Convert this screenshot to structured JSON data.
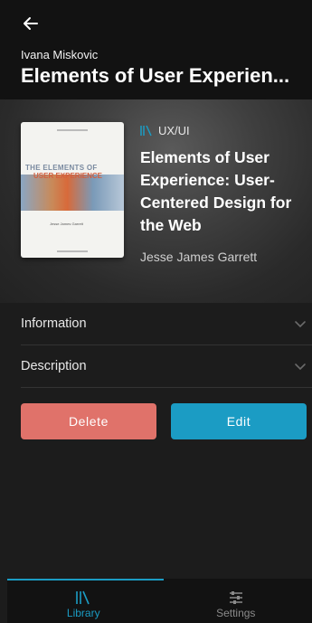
{
  "header": {
    "subtitle": "Ivana Miskovic",
    "title": "Elements of User Experien..."
  },
  "book": {
    "category": "UX/UI",
    "title": "Elements of User Experience: User-Centered Design for the Web",
    "author": "Jesse James Garrett",
    "cover_line1": "THE ELEMENTS OF",
    "cover_line2": "USER EXPERIENCE",
    "cover_author": "Jesse James Garrett"
  },
  "sections": [
    {
      "label": "Information"
    },
    {
      "label": "Description"
    }
  ],
  "actions": {
    "delete_label": "Delete",
    "edit_label": "Edit"
  },
  "nav": {
    "tabs": [
      {
        "label": "Library",
        "icon": "library-icon",
        "active": true
      },
      {
        "label": "Settings",
        "icon": "settings-sliders-icon",
        "active": false
      }
    ]
  },
  "colors": {
    "accent": "#1b9cc4",
    "delete": "#e0726a",
    "background": "#1c1c1c"
  }
}
